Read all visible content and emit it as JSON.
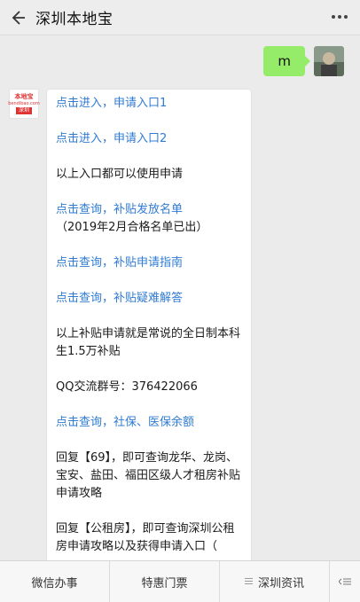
{
  "header": {
    "title": "深圳本地宝"
  },
  "user_message": {
    "text": "m"
  },
  "bot_avatar": {
    "line1": "本地宝",
    "line2": "bendibao.com",
    "line3": "深圳"
  },
  "bot_message": {
    "paragraphs": [
      {
        "text": "点击进入，申请入口1",
        "type": "link"
      },
      {
        "text": "点击进入，申请入口2",
        "type": "link"
      },
      {
        "text": "以上入口都可以使用申请",
        "type": "plain"
      },
      {
        "text": "点击查询，补贴发放名单",
        "sub": "（2019年2月合格名单已出）",
        "type": "link"
      },
      {
        "text": "点击查询，补贴申请指南",
        "type": "link"
      },
      {
        "text": "点击查询，补贴疑难解答",
        "type": "link"
      },
      {
        "text": "以上补贴申请就是常说的全日制本科生1.5万补贴",
        "type": "plain"
      },
      {
        "text": "QQ交流群号：376422066",
        "type": "plain"
      },
      {
        "text": "点击查询，社保、医保余额",
        "type": "link"
      },
      {
        "text": "回复【69】，即可查询龙华、龙岗、宝安、盐田、福田区级人才租房补贴申请攻略",
        "type": "plain"
      },
      {
        "text": "回复【公租房】，即可查询深圳公租房申请攻略以及获得申请入口（",
        "type": "plain"
      }
    ]
  },
  "bottom_menu": {
    "items": [
      {
        "label": "微信办事"
      },
      {
        "label": "特惠门票"
      },
      {
        "label": "深圳资讯"
      }
    ]
  },
  "colors": {
    "link": "#2f7bd3",
    "user_bubble": "#95ec69",
    "background": "#ebebeb"
  }
}
